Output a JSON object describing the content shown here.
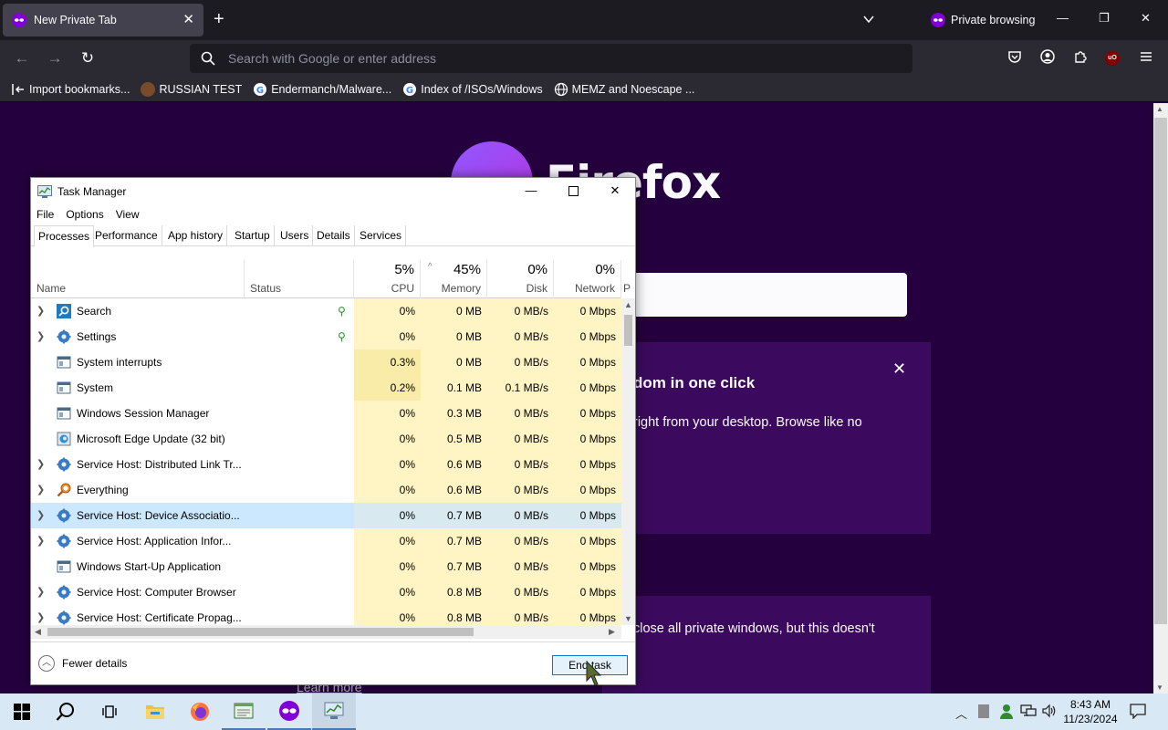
{
  "browser": {
    "tab_title": "New Private Tab",
    "private_label": "Private browsing",
    "address_placeholder": "Search with Google or enter address",
    "bookmarks": [
      "Import bookmarks...",
      "RUSSIAN TEST",
      "Endermanch/Malware...",
      "Index of /ISOs/Windows",
      "MEMZ and Noescape ..."
    ]
  },
  "newtab_page": {
    "wordmark": "Firefox",
    "promo_title": "dom in one click",
    "promo_text": "right from your desktop. Browse like no",
    "info_text": "close all private windows, but this doesn't",
    "learn_more": "Learn more"
  },
  "task_manager": {
    "title": "Task Manager",
    "menu": [
      "File",
      "Options",
      "View"
    ],
    "tabs": [
      "Processes",
      "Performance",
      "App history",
      "Startup",
      "Users",
      "Details",
      "Services"
    ],
    "active_tab": "Processes",
    "columns": {
      "name": "Name",
      "status": "Status",
      "cpu": {
        "pct": "5%",
        "label": "CPU"
      },
      "memory": {
        "pct": "45%",
        "label": "Memory"
      },
      "disk": {
        "pct": "0%",
        "label": "Disk"
      },
      "network": {
        "pct": "0%",
        "label": "Network"
      },
      "power_trunc": "P"
    },
    "processes": [
      {
        "name": "Search",
        "cpu": "0%",
        "memory": "0 MB",
        "disk": "0 MB/s",
        "network": "0 Mbps",
        "expandable": true,
        "suspended": true,
        "icon": "search-app-icon"
      },
      {
        "name": "Settings",
        "cpu": "0%",
        "memory": "0 MB",
        "disk": "0 MB/s",
        "network": "0 Mbps",
        "expandable": true,
        "suspended": true,
        "icon": "gear-icon"
      },
      {
        "name": "System interrupts",
        "cpu": "0.3%",
        "memory": "0 MB",
        "disk": "0 MB/s",
        "network": "0 Mbps",
        "expandable": false,
        "icon": "window-icon"
      },
      {
        "name": "System",
        "cpu": "0.2%",
        "memory": "0.1 MB",
        "disk": "0.1 MB/s",
        "network": "0 Mbps",
        "expandable": false,
        "icon": "window-icon"
      },
      {
        "name": "Windows Session Manager",
        "cpu": "0%",
        "memory": "0.3 MB",
        "disk": "0 MB/s",
        "network": "0 Mbps",
        "expandable": false,
        "icon": "window-icon"
      },
      {
        "name": "Microsoft Edge Update (32 bit)",
        "cpu": "0%",
        "memory": "0.5 MB",
        "disk": "0 MB/s",
        "network": "0 Mbps",
        "expandable": false,
        "icon": "edge-update-icon"
      },
      {
        "name": "Service Host: Distributed Link Tr...",
        "cpu": "0%",
        "memory": "0.6 MB",
        "disk": "0 MB/s",
        "network": "0 Mbps",
        "expandable": true,
        "icon": "gear-icon"
      },
      {
        "name": "Everything",
        "cpu": "0%",
        "memory": "0.6 MB",
        "disk": "0 MB/s",
        "network": "0 Mbps",
        "expandable": true,
        "icon": "magnifier-icon"
      },
      {
        "name": "Service Host: Device Associatio...",
        "cpu": "0%",
        "memory": "0.7 MB",
        "disk": "0 MB/s",
        "network": "0 Mbps",
        "expandable": true,
        "selected": true,
        "icon": "gear-icon"
      },
      {
        "name": "Service Host: Application Infor...",
        "cpu": "0%",
        "memory": "0.7 MB",
        "disk": "0 MB/s",
        "network": "0 Mbps",
        "expandable": true,
        "icon": "gear-icon"
      },
      {
        "name": "Windows Start-Up Application",
        "cpu": "0%",
        "memory": "0.7 MB",
        "disk": "0 MB/s",
        "network": "0 Mbps",
        "expandable": false,
        "icon": "window-icon"
      },
      {
        "name": "Service Host: Computer Browser",
        "cpu": "0%",
        "memory": "0.8 MB",
        "disk": "0 MB/s",
        "network": "0 Mbps",
        "expandable": true,
        "icon": "gear-icon"
      },
      {
        "name": "Service Host: Certificate Propag...",
        "cpu": "0%",
        "memory": "0.8 MB",
        "disk": "0 MB/s",
        "network": "0 Mbps",
        "expandable": true,
        "icon": "gear-icon"
      }
    ],
    "fewer_details": "Fewer details",
    "end_task": "End task"
  },
  "taskbar": {
    "apps": [
      "windows-start-icon",
      "search-icon",
      "task-view-icon",
      "file-explorer-icon",
      "firefox-icon",
      "notepad-icon",
      "firefox-private-icon",
      "task-manager-icon"
    ],
    "time": "8:43 AM",
    "date": "11/23/2024"
  },
  "colors": {
    "page_bg": "#25003e",
    "accent": "#0078d7",
    "cpu_heat": "#f9eca8",
    "selection": "#cce8ff"
  }
}
